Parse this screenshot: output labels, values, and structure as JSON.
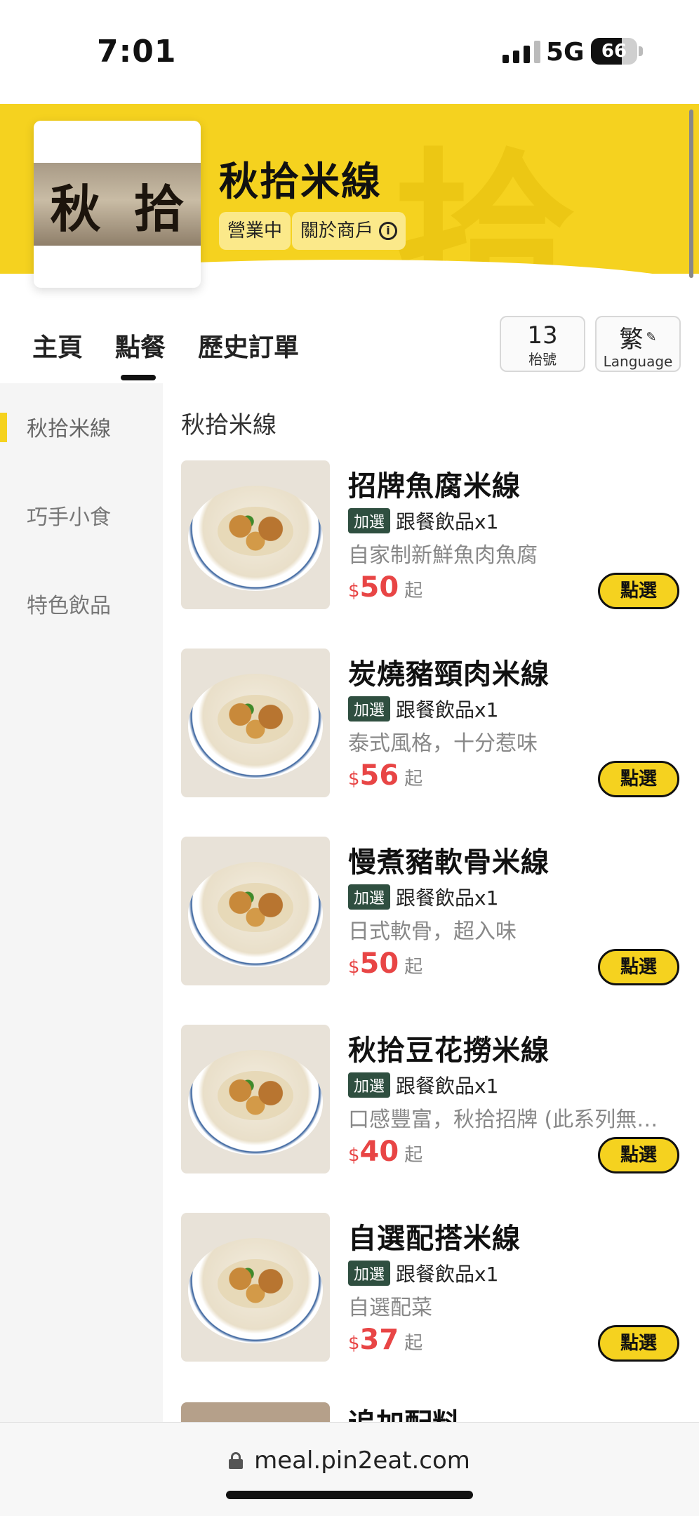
{
  "status_bar": {
    "time": "7:01",
    "network": "5G",
    "battery": "66",
    "battery_level": 0.66
  },
  "store": {
    "name": "秋拾米線",
    "logo_chars": [
      "秋",
      "拾"
    ],
    "status_badge": "營業中",
    "about_label": "關於商戶"
  },
  "nav": {
    "tabs": [
      {
        "label": "主頁"
      },
      {
        "label": "點餐",
        "active": true
      },
      {
        "label": "歷史訂單"
      }
    ],
    "table_number": "13",
    "table_label": "枱號",
    "language_char": "繁",
    "language_label": "Language"
  },
  "sidebar": {
    "categories": [
      {
        "label": "秋拾米線",
        "active": true
      },
      {
        "label": "巧手小食"
      },
      {
        "label": "特色飲品"
      }
    ]
  },
  "menu": {
    "section_title": "秋拾米線",
    "addon_tag": "加選",
    "addon_text": "跟餐飲品x1",
    "currency": "$",
    "price_suffix": "起",
    "select_label": "點選",
    "items": [
      {
        "name": "招牌魚腐米線",
        "desc": "自家制新鮮魚肉魚腐",
        "price": "50"
      },
      {
        "name": "炭燒豬頸肉米線",
        "desc": "泰式風格，十分惹味",
        "price": "56"
      },
      {
        "name": "慢煮豬軟骨米線",
        "desc": "日式軟骨，超入味",
        "price": "50"
      },
      {
        "name": "秋拾豆花撈米線",
        "desc": "口感豐富，秋拾招牌 (此系列無…",
        "price": "40"
      },
      {
        "name": "自選配搭米線",
        "desc": "自選配菜",
        "price": "37"
      }
    ],
    "partial_item_name": "追加配料"
  },
  "browser": {
    "url": "meal.pin2eat.com"
  },
  "colors": {
    "brand_yellow": "#f5d21f",
    "price_red": "#e84545",
    "addon_green": "#2f4f40"
  }
}
